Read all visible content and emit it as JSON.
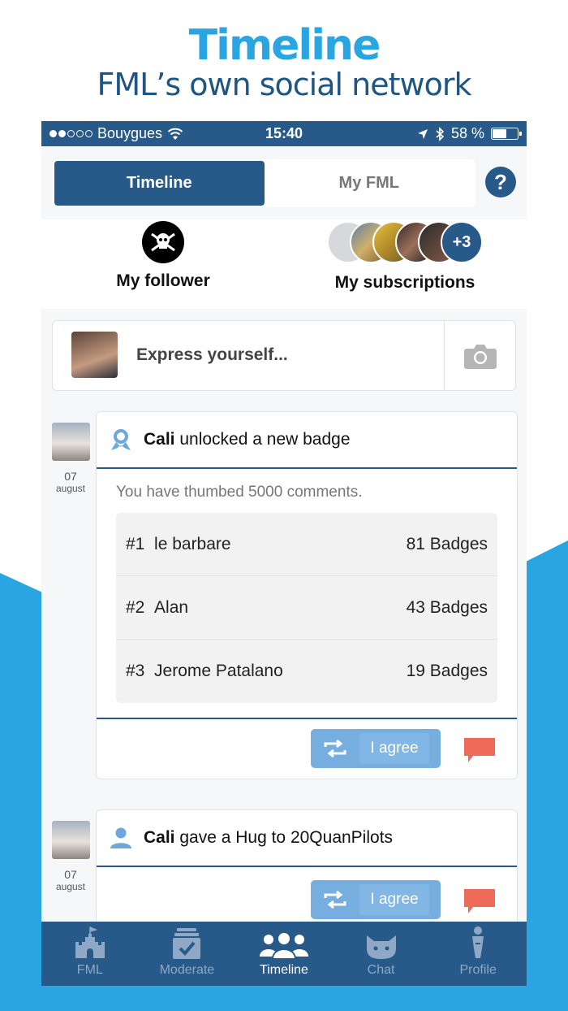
{
  "promo": {
    "title": "Timeline",
    "subtitle": "FML’s own social network"
  },
  "status_bar": {
    "carrier": "Bouygues",
    "time": "15:40",
    "battery": "58 %",
    "battery_level": 0.58
  },
  "header": {
    "tabs": [
      {
        "label": "Timeline",
        "active": true
      },
      {
        "label": "My FML",
        "active": false
      }
    ],
    "help_label": "?"
  },
  "follow": {
    "follower_label": "My follower",
    "subscriptions_label": "My subscriptions",
    "subscriptions_more": "+3"
  },
  "composer": {
    "placeholder": "Express yourself...",
    "camera_icon": "camera-icon"
  },
  "feed": [
    {
      "user": "Cali",
      "action": " unlocked a new badge",
      "icon": "badge-ribbon-icon",
      "day": "07",
      "month": "august",
      "description": "You have thumbed 5000 comments.",
      "ranking": [
        {
          "rank": "#1",
          "name": "le barbare",
          "badges": "81 Badges"
        },
        {
          "rank": "#2",
          "name": "Alan",
          "badges": "43 Badges"
        },
        {
          "rank": "#3",
          "name": "Jerome Patalano",
          "badges": "19 Badges"
        }
      ],
      "agree_label": "I agree"
    },
    {
      "user": "Cali",
      "action": " gave a Hug to 20QuanPilots",
      "icon": "person-icon",
      "day": "07",
      "month": "august",
      "agree_label": "I agree"
    }
  ],
  "tabbar": [
    {
      "label": "FML",
      "icon": "castle-icon",
      "active": false
    },
    {
      "label": "Moderate",
      "icon": "moderate-check-icon",
      "active": false
    },
    {
      "label": "Timeline",
      "icon": "group-icon",
      "active": true
    },
    {
      "label": "Chat",
      "icon": "cat-icon",
      "active": false
    },
    {
      "label": "Profile",
      "icon": "profile-figure-icon",
      "active": false
    }
  ],
  "colors": {
    "brand_dark": "#275989",
    "brand_light": "#29a5e2",
    "agree_button": "#77aee0",
    "comment": "#ef6a58"
  }
}
